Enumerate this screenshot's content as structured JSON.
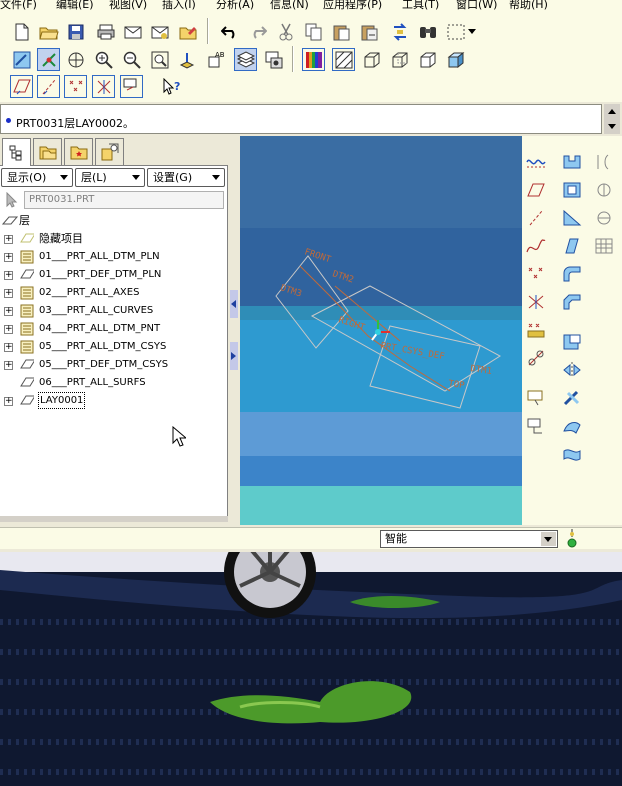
{
  "menu": [
    {
      "label": "文件(F)"
    },
    {
      "label": "编辑(E)"
    },
    {
      "label": "视图(V)"
    },
    {
      "label": "插入(I)"
    },
    {
      "label": "分析(A)"
    },
    {
      "label": "信息(N)"
    },
    {
      "label": "应用程序(P)"
    },
    {
      "label": "工具(T)"
    },
    {
      "label": "窗口(W)"
    },
    {
      "label": "帮助(H)"
    }
  ],
  "message_area": {
    "text": "PRT0031层LAY0002。"
  },
  "panel": {
    "tabs": [
      {
        "icon": "model-tree-icon"
      },
      {
        "icon": "folder-browser-icon"
      },
      {
        "icon": "favorites-icon"
      },
      {
        "icon": "connections-icon"
      }
    ],
    "dropdowns": {
      "display": "显示(O)",
      "layer": "层(L)",
      "settings": "设置(G)"
    },
    "model_path": "PRT0031.PRT",
    "tree": {
      "root": "层",
      "items": [
        {
          "label": "隐藏项目",
          "icon": "hidden-items-icon"
        },
        {
          "label": "01___PRT_ALL_DTM_PLN",
          "icon": "layer-icon"
        },
        {
          "label": "01___PRT_DEF_DTM_PLN",
          "icon": "layer-empty-icon"
        },
        {
          "label": "02___PRT_ALL_AXES",
          "icon": "layer-icon"
        },
        {
          "label": "03___PRT_ALL_CURVES",
          "icon": "layer-icon"
        },
        {
          "label": "04___PRT_ALL_DTM_PNT",
          "icon": "layer-icon"
        },
        {
          "label": "05___PRT_ALL_DTM_CSYS",
          "icon": "layer-icon"
        },
        {
          "label": "05___PRT_DEF_DTM_CSYS",
          "icon": "layer-empty-icon"
        },
        {
          "label": "06___PRT_ALL_SURFS",
          "icon": "layer-empty-icon"
        },
        {
          "label": "LAY0001",
          "icon": "layer-empty-icon"
        }
      ]
    }
  },
  "viewport": {
    "labels": {
      "front": "FRONT",
      "csys": "PRT_CSYS_DEF",
      "top": "TOP",
      "dtm1": "DTM1",
      "dtm2": "DTM2",
      "dtm3": "DTM3",
      "right": "RIGHT"
    },
    "colors": {
      "sky": "#3b6ea5",
      "band": "#2e9ad0",
      "teal": "#5ecbcb",
      "datum": "#c06a3a"
    }
  },
  "status": {
    "filter": "智能"
  }
}
